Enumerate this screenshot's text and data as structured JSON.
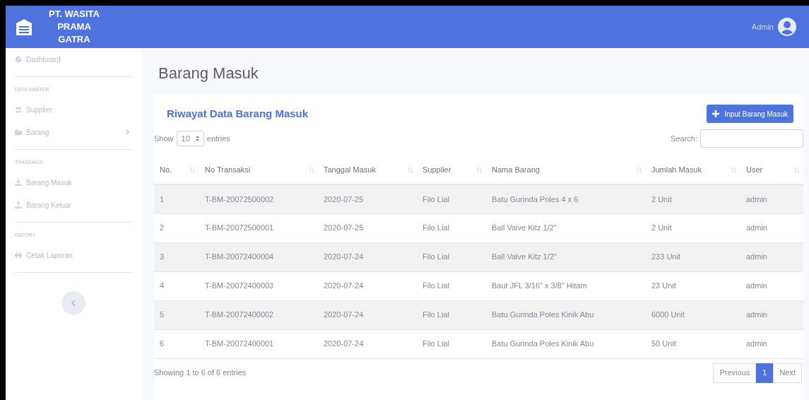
{
  "brand": {
    "lines": [
      "PT. WASITA",
      "PRAMA",
      "GATRA"
    ]
  },
  "user": {
    "name": "Admin"
  },
  "sidebar": [
    {
      "kind": "item",
      "label": "Dashboard",
      "chevron": false
    },
    {
      "kind": "divider"
    },
    {
      "kind": "heading",
      "label": "DATA MASTER"
    },
    {
      "kind": "item",
      "label": "Supplier",
      "chevron": false
    },
    {
      "kind": "item",
      "label": "Barang",
      "chevron": true
    },
    {
      "kind": "divider"
    },
    {
      "kind": "heading",
      "label": "TRANSAKSI"
    },
    {
      "kind": "item",
      "label": "Barang Masuk",
      "chevron": false
    },
    {
      "kind": "item",
      "label": "Barang Keluar",
      "chevron": false
    },
    {
      "kind": "divider"
    },
    {
      "kind": "heading",
      "label": "REPORT"
    },
    {
      "kind": "item",
      "label": "Cetak Laporan",
      "chevron": false
    },
    {
      "kind": "divider"
    }
  ],
  "page_title": "Barang Masuk",
  "card": {
    "title": "Riwayat Data Barang Masuk",
    "add_button": "Input Barang Masuk",
    "length": {
      "before": "Show",
      "value": "10",
      "after": "entries"
    },
    "search_label": "Search:",
    "table": {
      "columns": [
        "No.",
        "No Transaksi",
        "Tanggal Masuk",
        "Supplier",
        "Nama Barang",
        "Jumlah Masuk",
        "User"
      ],
      "rows": [
        [
          "1",
          "T-BM-20072500002",
          "2020-07-25",
          "Filo Lial",
          "Batu Gurinda Poles 4 x 6",
          "2 Unit",
          "admin"
        ],
        [
          "2",
          "T-BM-20072500001",
          "2020-07-25",
          "Filo Lial",
          "Ball Valve Kitz 1/2\"",
          "2 Unit",
          "admin"
        ],
        [
          "3",
          "T-BM-20072400004",
          "2020-07-24",
          "Filo Lial",
          "Ball Valve Kitz 1/2\"",
          "233 Unit",
          "admin"
        ],
        [
          "4",
          "T-BM-20072400003",
          "2020-07-24",
          "Filo Lial",
          "Baut JFL 3/16\" x 3/8\" Hitam",
          "23 Unit",
          "admin"
        ],
        [
          "5",
          "T-BM-20072400002",
          "2020-07-24",
          "Filo Lial",
          "Batu Gurinda Poles Kinik Abu",
          "6000 Unit",
          "admin"
        ],
        [
          "6",
          "T-BM-20072400001",
          "2020-07-24",
          "Filo Lial",
          "Batu Gurinda Poles Kinik Abu",
          "50 Unit",
          "admin"
        ]
      ]
    },
    "info": "Showing 1 to 6 of 6 entries",
    "pagination": [
      {
        "label": "Previous",
        "selected": false
      },
      {
        "label": "1",
        "selected": true
      },
      {
        "label": "Next",
        "selected": false
      }
    ]
  }
}
